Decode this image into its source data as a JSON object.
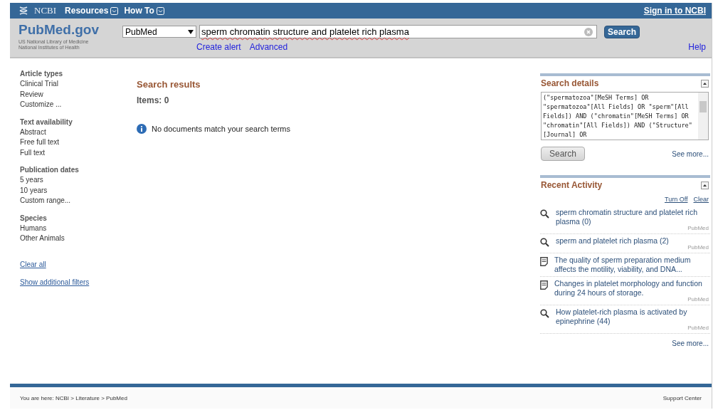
{
  "topbar": {
    "brand": "NCBI",
    "menus": [
      {
        "label": "Resources"
      },
      {
        "label": "How To"
      }
    ],
    "signin": "Sign in to NCBI"
  },
  "header": {
    "logo": "PubMed.gov",
    "org_lines": [
      "US National Library of Medicine",
      "National Institutes of Health"
    ],
    "database": "PubMed",
    "query": "sperm chromatin structure and platelet rich plasma",
    "search_button": "Search",
    "links": [
      "Create alert",
      "Advanced"
    ],
    "help": "Help"
  },
  "filters": [
    {
      "title": "Article types",
      "items": [
        "Clinical Trial",
        "Review",
        "Customize ..."
      ]
    },
    {
      "title": "Text availability",
      "items": [
        "Abstract",
        "Free full text",
        "Full text"
      ]
    },
    {
      "title": "Publication dates",
      "items": [
        "5 years",
        "10 years",
        "Custom range..."
      ]
    },
    {
      "title": "Species",
      "items": [
        "Humans",
        "Other Animals"
      ]
    }
  ],
  "filter_links": [
    "Clear all",
    "Show additional filters"
  ],
  "results": {
    "title": "Search results",
    "items": "Items: 0",
    "message": "No documents match your search terms"
  },
  "search_details": {
    "title": "Search details",
    "query": "(\"spermatozoa\"[MeSH Terms] OR \"spermatozoa\"[All Fields] OR \"sperm\"[All Fields]) AND (\"chromatin\"[MeSH Terms] OR \"chromatin\"[All Fields]) AND (\"Structure\"[Journal] OR",
    "button": "Search",
    "see_more": "See more..."
  },
  "recent_activity": {
    "title": "Recent Activity",
    "actions": [
      "Turn Off",
      "Clear"
    ],
    "items": [
      {
        "kind": "search",
        "text": "sperm chromatin structure and platelet rich plasma (0)",
        "source": "PubMed"
      },
      {
        "kind": "search",
        "text": "sperm and platelet rich plasma (2)",
        "source": "PubMed"
      },
      {
        "kind": "document",
        "text": "The quality of sperm preparation medium affects the motility, viability, and DNA..."
      },
      {
        "kind": "document",
        "text": "Changes in platelet morphology and function during 24 hours of storage.",
        "source": "PubMed"
      },
      {
        "kind": "search",
        "text": "How platelet-rich plasma is activated by epinephrine (44)",
        "source": "PubMed"
      }
    ],
    "see_more": "See more..."
  },
  "footer": {
    "breadcrumb": "You are here: NCBI > Literature > PubMed",
    "support": "Support Center"
  }
}
